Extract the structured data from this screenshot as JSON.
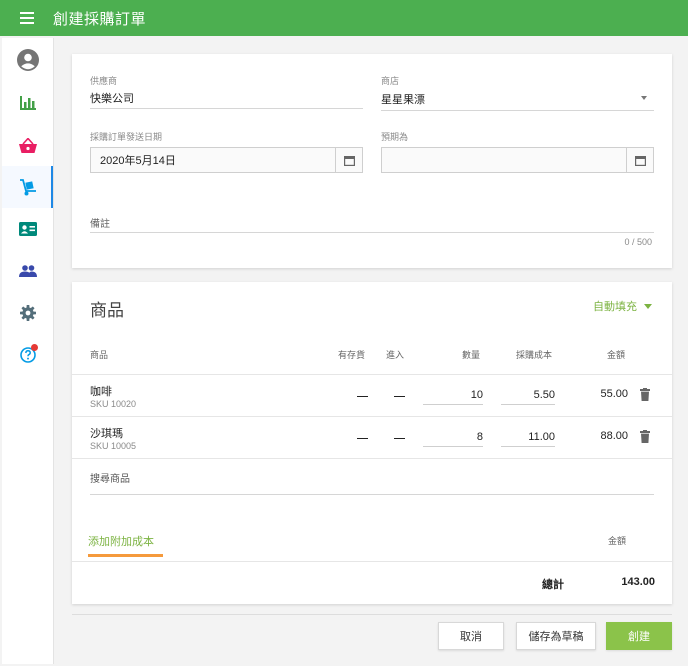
{
  "header": {
    "title": "創建採購訂單"
  },
  "sidebar": {
    "items": [
      {
        "icon": "account-circle-icon"
      },
      {
        "icon": "bar-chart-icon"
      },
      {
        "icon": "basket-icon"
      },
      {
        "icon": "hand-truck-icon",
        "active": true
      },
      {
        "icon": "id-card-icon"
      },
      {
        "icon": "people-icon"
      },
      {
        "icon": "gear-icon"
      },
      {
        "icon": "help-icon",
        "badge": true
      }
    ]
  },
  "details": {
    "supplier_label": "供應商",
    "supplier_value": "快樂公司",
    "store_label": "商店",
    "store_value": "星星果漂",
    "date_label": "採購訂單發送日期",
    "date_value": "2020年5月14日",
    "expected_label": "預期為",
    "expected_value": "",
    "note_label": "備註",
    "note_counter": "0 / 500"
  },
  "products": {
    "title": "商品",
    "autofill_label": "自動填充",
    "columns": {
      "item": "商品",
      "in_stock": "有存貨",
      "incoming": "進入",
      "quantity": "數量",
      "cost": "採購成本",
      "amount": "金額"
    },
    "rows": [
      {
        "name": "咖啡",
        "sku": "SKU 10020",
        "quantity": "10",
        "cost": "5.50",
        "amount": "55.00"
      },
      {
        "name": "沙琪瑪",
        "sku": "SKU 10005",
        "quantity": "8",
        "cost": "11.00",
        "amount": "88.00"
      }
    ],
    "search_label": "搜尋商品",
    "add_cost_label": "添加附加成本",
    "extra_amount_label": "金額",
    "total_label": "總計",
    "total_value": "143.00"
  },
  "actions": {
    "cancel": "取消",
    "save_draft": "儲存為草稿",
    "create": "創建"
  },
  "colors": {
    "header": "#4caf50",
    "accent_green": "#7cb342",
    "primary_button": "#8bc34a",
    "tab_underline": "#f59a3c",
    "active_indicator": "#1e88e5"
  }
}
